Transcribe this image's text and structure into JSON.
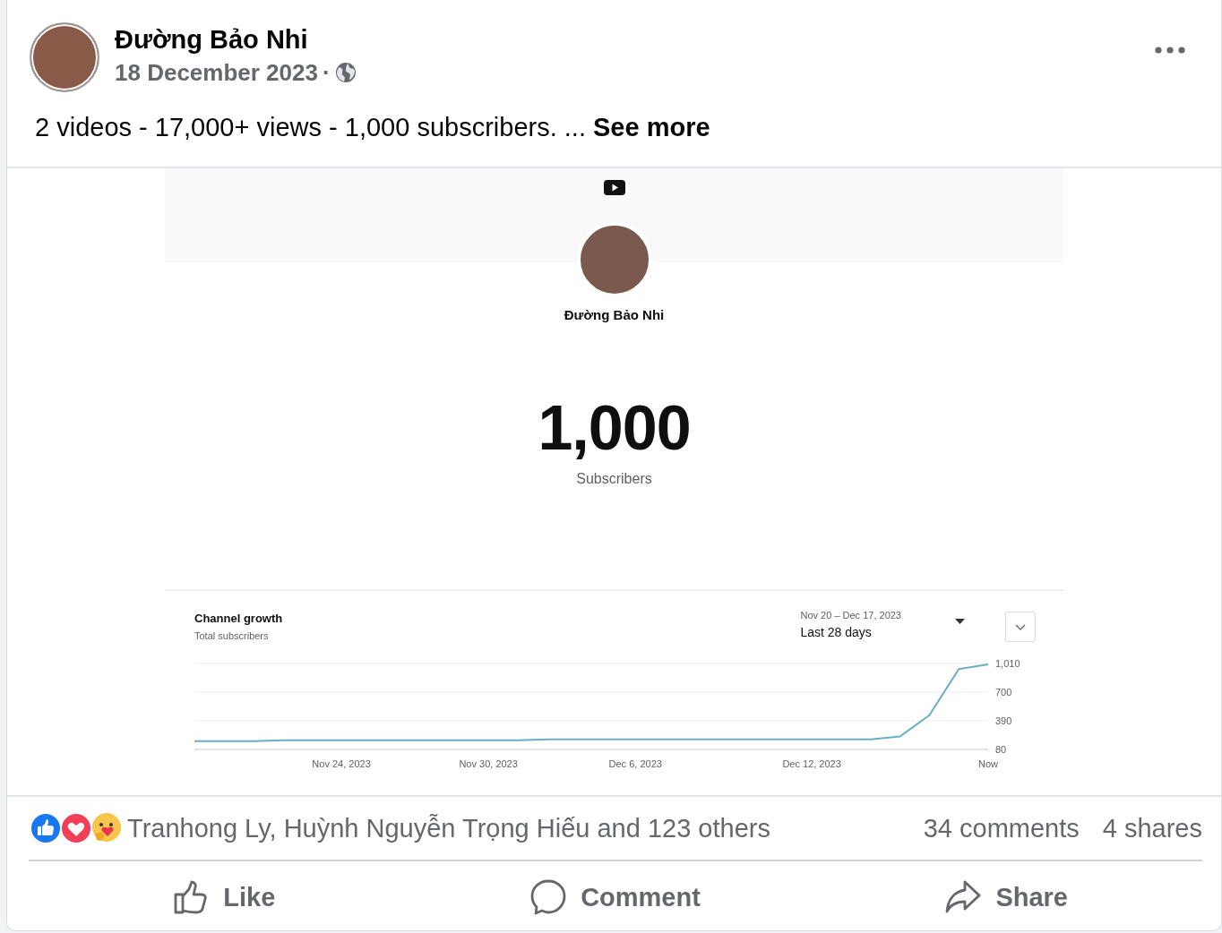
{
  "post": {
    "author": "Đường Bảo Nhi",
    "date": "18 December 2023",
    "separator": "·",
    "text": "2 videos - 17,000+ views - 1,000 subscribers. ...",
    "see_more": "See more"
  },
  "media": {
    "channel_name": "Đường Bảo Nhi",
    "subscriber_count": "1,000",
    "subscriber_label": "Subscribers",
    "growth": {
      "title": "Channel growth",
      "subtitle": "Total subscribers",
      "date_range": "Nov 20 – Dec 17, 2023",
      "period": "Last 28 days",
      "chart_data": {
        "type": "line",
        "categories": [
          null,
          null,
          null,
          null,
          null,
          "Nov 24, 2023",
          null,
          null,
          null,
          null,
          "Nov 30, 2023",
          null,
          null,
          null,
          null,
          "Dec 6, 2023",
          null,
          null,
          null,
          null,
          null,
          "Dec 12, 2023",
          null,
          null,
          null,
          null,
          null,
          "Now"
        ],
        "yticks": [
          80,
          390,
          700,
          {
            "value": 1010,
            "label": "1,010"
          }
        ],
        "ylim": [
          80,
          1010
        ],
        "series": [
          {
            "color": "#6aaec6",
            "values": [
              170,
              170,
              170,
              180,
              180,
              180,
              180,
              180,
              180,
              180,
              180,
              180,
              190,
              190,
              190,
              190,
              190,
              190,
              190,
              190,
              190,
              190,
              190,
              190,
              220,
              450,
              950,
              1000
            ]
          }
        ]
      }
    }
  },
  "footer": {
    "reactions_text": "Tranhong Ly, Huỳnh Nguyễn Trọng Hiếu and 123 others",
    "comments": "34 comments",
    "shares": "4 shares",
    "actions": [
      {
        "kind": "like",
        "label": "Like"
      },
      {
        "kind": "comment",
        "label": "Comment"
      },
      {
        "kind": "share",
        "label": "Share"
      }
    ]
  }
}
